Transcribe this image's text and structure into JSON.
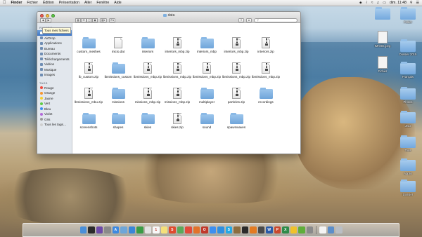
{
  "menubar": {
    "app": "Finder",
    "menus": [
      "Fichier",
      "Édition",
      "Présentation",
      "Aller",
      "Fenêtre",
      "Aide"
    ],
    "clock": "dim. 11:48"
  },
  "window": {
    "title": "data"
  },
  "sidebar": {
    "favorites_header": "FAVORIS",
    "favorites": [
      {
        "label": "Tous mes fichiers",
        "selected": true
      },
      {
        "label": "AirDrop"
      },
      {
        "label": "Applications"
      },
      {
        "label": "Bureau"
      },
      {
        "label": "Documents"
      },
      {
        "label": "Téléchargements"
      },
      {
        "label": "Vidéos"
      },
      {
        "label": "Musique"
      },
      {
        "label": "Images"
      }
    ],
    "tags_header": "TAGS",
    "tags": [
      {
        "label": "Rouge",
        "color": "#f04a3e"
      },
      {
        "label": "Orange",
        "color": "#f7962f"
      },
      {
        "label": "Jaune",
        "color": "#f5d033"
      },
      {
        "label": "Vert",
        "color": "#5fcc47"
      },
      {
        "label": "Bleu",
        "color": "#3d8ff0"
      },
      {
        "label": "Violet",
        "color": "#b36ad9"
      },
      {
        "label": "Gris",
        "color": "#9a9a9a"
      },
      {
        "label": "Tous les tags…",
        "color": "#cfcfcf"
      }
    ]
  },
  "tooltip": "Tous mes fichiers",
  "files": [
    {
      "label": "custom_meshes",
      "type": "folder"
    },
    {
      "label": "inicio.dat",
      "type": "file"
    },
    {
      "label": "interiors",
      "type": "folder"
    },
    {
      "label": "interiors_mbp.zip",
      "type": "zip"
    },
    {
      "label": "interiors_mbp",
      "type": "folder"
    },
    {
      "label": "interiors_mbp.zip",
      "type": "zip"
    },
    {
      "label": "interiors.zip",
      "type": "zip"
    },
    {
      "label": "lb_custom.zip",
      "type": "zip"
    },
    {
      "label": "lbmissions_custom",
      "type": "folder"
    },
    {
      "label": "lbmissions_mbp.zip",
      "type": "zip"
    },
    {
      "label": "lbmissions_mbp.zip",
      "type": "zip"
    },
    {
      "label": "lbmissions_mbp.zip",
      "type": "zip"
    },
    {
      "label": "lbmissions_mbp.zip",
      "type": "zip"
    },
    {
      "label": "lbmissions_mbp.zip",
      "type": "zip"
    },
    {
      "label": "lbmissions_mbu.zip",
      "type": "zip"
    },
    {
      "label": "missions",
      "type": "folder"
    },
    {
      "label": "missions_mbp.zip",
      "type": "zip"
    },
    {
      "label": "missions_mbp.zip",
      "type": "zip"
    },
    {
      "label": "multiplayer",
      "type": "folder"
    },
    {
      "label": "particles.zip",
      "type": "zip"
    },
    {
      "label": "recordings",
      "type": "folder"
    },
    {
      "label": "screenshots",
      "type": "folder"
    },
    {
      "label": "shapes",
      "type": "folder"
    },
    {
      "label": "skies",
      "type": "folder"
    },
    {
      "label": "skies.zip",
      "type": "zip"
    },
    {
      "label": "sound",
      "type": "folder"
    },
    {
      "label": "spawnwaves",
      "type": "folder"
    }
  ],
  "desktop": {
    "icons": [
      {
        "label": "",
        "type": "folder"
      },
      {
        "label": "Folder",
        "type": "folder"
      },
      {
        "label": "IMAGE.jpeg",
        "type": "file"
      },
      {
        "label": "Dossier 2015",
        "type": "folder"
      },
      {
        "label": "Fichier",
        "type": "file"
      },
      {
        "label": "Français",
        "type": "folder"
      },
      {
        "label": "Photos",
        "type": "folder"
      },
      {
        "label": "Jeux",
        "type": "folder"
      },
      {
        "label": "Tous",
        "type": "folder"
      },
      {
        "label": "Applis",
        "type": "folder"
      },
      {
        "label": "Dossier",
        "type": "folder"
      }
    ]
  },
  "dock": {
    "apps": [
      {
        "name": "finder-icon",
        "color": "#4a8fd8",
        "glyph": ""
      },
      {
        "name": "dashboard-icon",
        "color": "#2b2b2b",
        "glyph": ""
      },
      {
        "name": "mission-control-icon",
        "color": "#6d4aa8",
        "glyph": ""
      },
      {
        "name": "launchpad-icon",
        "color": "#8a8a8a",
        "glyph": ""
      },
      {
        "name": "app-store-icon",
        "color": "#3e89e0",
        "glyph": "A"
      },
      {
        "name": "mail-icon",
        "color": "#6fa6d8",
        "glyph": ""
      },
      {
        "name": "safari-icon",
        "color": "#3a86d8",
        "glyph": ""
      },
      {
        "name": "facetime-icon",
        "color": "#3a9c45",
        "glyph": ""
      },
      {
        "name": "photos-icon",
        "color": "#e3e3e3",
        "glyph": ""
      },
      {
        "name": "calendar-icon",
        "color": "#f8f8f8",
        "glyph": "1"
      },
      {
        "name": "notes-icon",
        "color": "#f5e07a",
        "glyph": ""
      },
      {
        "name": "app-sc-icon",
        "color": "#e04b2f",
        "glyph": "S"
      },
      {
        "name": "maps-icon",
        "color": "#5aa95a",
        "glyph": ""
      },
      {
        "name": "chrome-icon",
        "color": "#e24a3a",
        "glyph": ""
      },
      {
        "name": "firefox-icon",
        "color": "#e2722a",
        "glyph": ""
      },
      {
        "name": "opera-icon",
        "color": "#c0392b",
        "glyph": "O"
      },
      {
        "name": "messages-icon",
        "color": "#3d8ff0",
        "glyph": ""
      },
      {
        "name": "telegram-icon",
        "color": "#2f8fe0",
        "glyph": ""
      },
      {
        "name": "skype-icon",
        "color": "#23a9e6",
        "glyph": "S"
      },
      {
        "name": "tools-icon",
        "color": "#8c6d3f",
        "glyph": ""
      },
      {
        "name": "terminal-icon",
        "color": "#2b2b2b",
        "glyph": ""
      },
      {
        "name": "vlc-icon",
        "color": "#e37b22",
        "glyph": ""
      },
      {
        "name": "games-icon",
        "color": "#4a4a4a",
        "glyph": ""
      },
      {
        "name": "word-icon",
        "color": "#2a5ba8",
        "glyph": "W"
      },
      {
        "name": "powerpoint-icon",
        "color": "#c9482d",
        "glyph": "P"
      },
      {
        "name": "excel-icon",
        "color": "#2e8b4a",
        "glyph": "X"
      },
      {
        "name": "yellow-app-icon",
        "color": "#f0c22a",
        "glyph": ""
      },
      {
        "name": "utorrent-icon",
        "color": "#5fae3a",
        "glyph": ""
      },
      {
        "name": "preferences-icon",
        "color": "#8a8a8a",
        "glyph": ""
      }
    ],
    "right": [
      {
        "name": "document-icon",
        "color": "#f4f4f4",
        "glyph": ""
      },
      {
        "name": "downloads-icon",
        "color": "#5c8ec9",
        "glyph": ""
      },
      {
        "name": "trash-icon",
        "color": "#b9bec4",
        "glyph": ""
      }
    ]
  }
}
